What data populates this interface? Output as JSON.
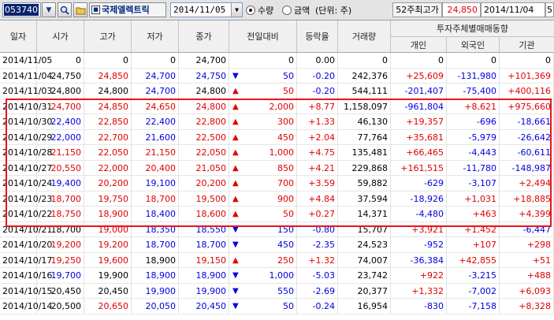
{
  "toolbar": {
    "stock_code": "053740",
    "stock_name": "국제엘렉트릭",
    "date": "2014/11/05",
    "radio_volume": "수량",
    "radio_amount": "금액",
    "unit": "(단위: 주)",
    "high52_label": "52주최고가",
    "high52_value": "24,850",
    "high52_date": "2014/11/04",
    "high52_more": "5"
  },
  "table": {
    "headers": {
      "date": "일자",
      "open": "시가",
      "high": "고가",
      "low": "저가",
      "close": "종가",
      "change": "전일대비",
      "rate": "등락율",
      "volume": "거래량",
      "investor_group": "투자주체별매매동향",
      "individual": "개인",
      "foreign": "외국인",
      "institution": "기관"
    },
    "rows": [
      {
        "date": "2014/11/05",
        "open": "0",
        "high": "0",
        "low": "0",
        "close": "24,700",
        "dir": "",
        "change": "0",
        "rate": "0.00",
        "volume": "0",
        "indiv": "0",
        "foreign": "0",
        "inst": "0",
        "oc": "",
        "hc": "",
        "lc": "",
        "cc": "",
        "ic": "",
        "fc": "",
        "tc": ""
      },
      {
        "date": "2014/11/04",
        "open": "24,750",
        "high": "24,850",
        "low": "24,700",
        "close": "24,750",
        "dir": "down",
        "change": "50",
        "rate": "-0.20",
        "volume": "242,376",
        "indiv": "+25,609",
        "foreign": "-131,980",
        "inst": "+101,369",
        "oc": "",
        "hc": "red",
        "lc": "blue",
        "cc": "blue",
        "ic": "red",
        "fc": "blue",
        "tc": "red"
      },
      {
        "date": "2014/11/03",
        "open": "24,800",
        "high": "24,800",
        "low": "24,700",
        "close": "24,800",
        "dir": "up",
        "change": "50",
        "rate": "-0.20",
        "volume": "544,111",
        "indiv": "-201,407",
        "foreign": "-75,400",
        "inst": "+400,116",
        "oc": "",
        "hc": "",
        "lc": "blue",
        "cc": "",
        "ic": "blue",
        "fc": "blue",
        "tc": "red"
      },
      {
        "date": "2014/10/31",
        "open": "24,700",
        "high": "24,850",
        "low": "24,650",
        "close": "24,800",
        "dir": "up",
        "change": "2,000",
        "rate": "+8.77",
        "volume": "1,158,097",
        "indiv": "-961,804",
        "foreign": "+8,621",
        "inst": "+975,660",
        "oc": "red",
        "hc": "red",
        "lc": "red",
        "cc": "red",
        "ic": "blue",
        "fc": "red",
        "tc": "red"
      },
      {
        "date": "2014/10/30",
        "open": "22,400",
        "high": "22,850",
        "low": "22,400",
        "close": "22,800",
        "dir": "up",
        "change": "300",
        "rate": "+1.33",
        "volume": "46,130",
        "indiv": "+19,357",
        "foreign": "-696",
        "inst": "-18,661",
        "oc": "blue",
        "hc": "red",
        "lc": "blue",
        "cc": "red",
        "ic": "red",
        "fc": "blue",
        "tc": "blue"
      },
      {
        "date": "2014/10/29",
        "open": "22,000",
        "high": "22,700",
        "low": "21,600",
        "close": "22,500",
        "dir": "up",
        "change": "450",
        "rate": "+2.04",
        "volume": "77,764",
        "indiv": "+35,681",
        "foreign": "-5,979",
        "inst": "-26,642",
        "oc": "blue",
        "hc": "red",
        "lc": "blue",
        "cc": "red",
        "ic": "red",
        "fc": "blue",
        "tc": "blue"
      },
      {
        "date": "2014/10/28",
        "open": "21,150",
        "high": "22,050",
        "low": "21,150",
        "close": "22,050",
        "dir": "up",
        "change": "1,000",
        "rate": "+4.75",
        "volume": "135,481",
        "indiv": "+66,465",
        "foreign": "-4,443",
        "inst": "-60,611",
        "oc": "red",
        "hc": "red",
        "lc": "red",
        "cc": "red",
        "ic": "red",
        "fc": "blue",
        "tc": "blue"
      },
      {
        "date": "2014/10/27",
        "open": "20,550",
        "high": "22,000",
        "low": "20,400",
        "close": "21,050",
        "dir": "up",
        "change": "850",
        "rate": "+4.21",
        "volume": "229,868",
        "indiv": "+161,515",
        "foreign": "-11,780",
        "inst": "-148,987",
        "oc": "red",
        "hc": "red",
        "lc": "red",
        "cc": "red",
        "ic": "red",
        "fc": "blue",
        "tc": "blue"
      },
      {
        "date": "2014/10/24",
        "open": "19,400",
        "high": "20,200",
        "low": "19,100",
        "close": "20,200",
        "dir": "up",
        "change": "700",
        "rate": "+3.59",
        "volume": "59,882",
        "indiv": "-629",
        "foreign": "-3,107",
        "inst": "+2,494",
        "oc": "blue",
        "hc": "red",
        "lc": "blue",
        "cc": "red",
        "ic": "blue",
        "fc": "blue",
        "tc": "red"
      },
      {
        "date": "2014/10/23",
        "open": "18,700",
        "high": "19,750",
        "low": "18,700",
        "close": "19,500",
        "dir": "up",
        "change": "900",
        "rate": "+4.84",
        "volume": "37,594",
        "indiv": "-18,926",
        "foreign": "+1,031",
        "inst": "+18,885",
        "oc": "red",
        "hc": "red",
        "lc": "red",
        "cc": "red",
        "ic": "blue",
        "fc": "red",
        "tc": "red"
      },
      {
        "date": "2014/10/22",
        "open": "18,750",
        "high": "18,900",
        "low": "18,400",
        "close": "18,600",
        "dir": "up",
        "change": "50",
        "rate": "+0.27",
        "volume": "14,371",
        "indiv": "-4,480",
        "foreign": "+463",
        "inst": "+4,399",
        "oc": "red",
        "hc": "red",
        "lc": "blue",
        "cc": "red",
        "ic": "blue",
        "fc": "red",
        "tc": "red"
      },
      {
        "date": "2014/10/21",
        "open": "18,700",
        "high": "19,000",
        "low": "18,350",
        "close": "18,550",
        "dir": "down",
        "change": "150",
        "rate": "-0.80",
        "volume": "15,707",
        "indiv": "+3,921",
        "foreign": "+1,452",
        "inst": "-6,447",
        "oc": "",
        "hc": "red",
        "lc": "blue",
        "cc": "blue",
        "ic": "red",
        "fc": "red",
        "tc": "blue"
      },
      {
        "date": "2014/10/20",
        "open": "19,200",
        "high": "19,200",
        "low": "18,700",
        "close": "18,700",
        "dir": "down",
        "change": "450",
        "rate": "-2.35",
        "volume": "24,523",
        "indiv": "-952",
        "foreign": "+107",
        "inst": "+298",
        "oc": "red",
        "hc": "red",
        "lc": "blue",
        "cc": "blue",
        "ic": "blue",
        "fc": "red",
        "tc": "red"
      },
      {
        "date": "2014/10/17",
        "open": "19,250",
        "high": "19,600",
        "low": "18,900",
        "close": "19,150",
        "dir": "up",
        "change": "250",
        "rate": "+1.32",
        "volume": "74,007",
        "indiv": "-36,384",
        "foreign": "+42,855",
        "inst": "+51",
        "oc": "red",
        "hc": "red",
        "lc": "",
        "cc": "red",
        "ic": "blue",
        "fc": "red",
        "tc": "red"
      },
      {
        "date": "2014/10/16",
        "open": "19,700",
        "high": "19,900",
        "low": "18,900",
        "close": "18,900",
        "dir": "down",
        "change": "1,000",
        "rate": "-5.03",
        "volume": "23,742",
        "indiv": "+922",
        "foreign": "-3,215",
        "inst": "+488",
        "oc": "blue",
        "hc": "",
        "lc": "blue",
        "cc": "blue",
        "ic": "red",
        "fc": "blue",
        "tc": "red"
      },
      {
        "date": "2014/10/15",
        "open": "20,450",
        "high": "20,450",
        "low": "19,900",
        "close": "19,900",
        "dir": "down",
        "change": "550",
        "rate": "-2.69",
        "volume": "20,377",
        "indiv": "+1,332",
        "foreign": "-7,002",
        "inst": "+6,093",
        "oc": "",
        "hc": "",
        "lc": "blue",
        "cc": "blue",
        "ic": "red",
        "fc": "blue",
        "tc": "red"
      },
      {
        "date": "2014/10/14",
        "open": "20,500",
        "high": "20,650",
        "low": "20,050",
        "close": "20,450",
        "dir": "down",
        "change": "50",
        "rate": "-0.24",
        "volume": "16,954",
        "indiv": "-830",
        "foreign": "-7,158",
        "inst": "+8,328",
        "oc": "",
        "hc": "red",
        "lc": "blue",
        "cc": "blue",
        "ic": "blue",
        "fc": "blue",
        "tc": "red"
      }
    ]
  }
}
